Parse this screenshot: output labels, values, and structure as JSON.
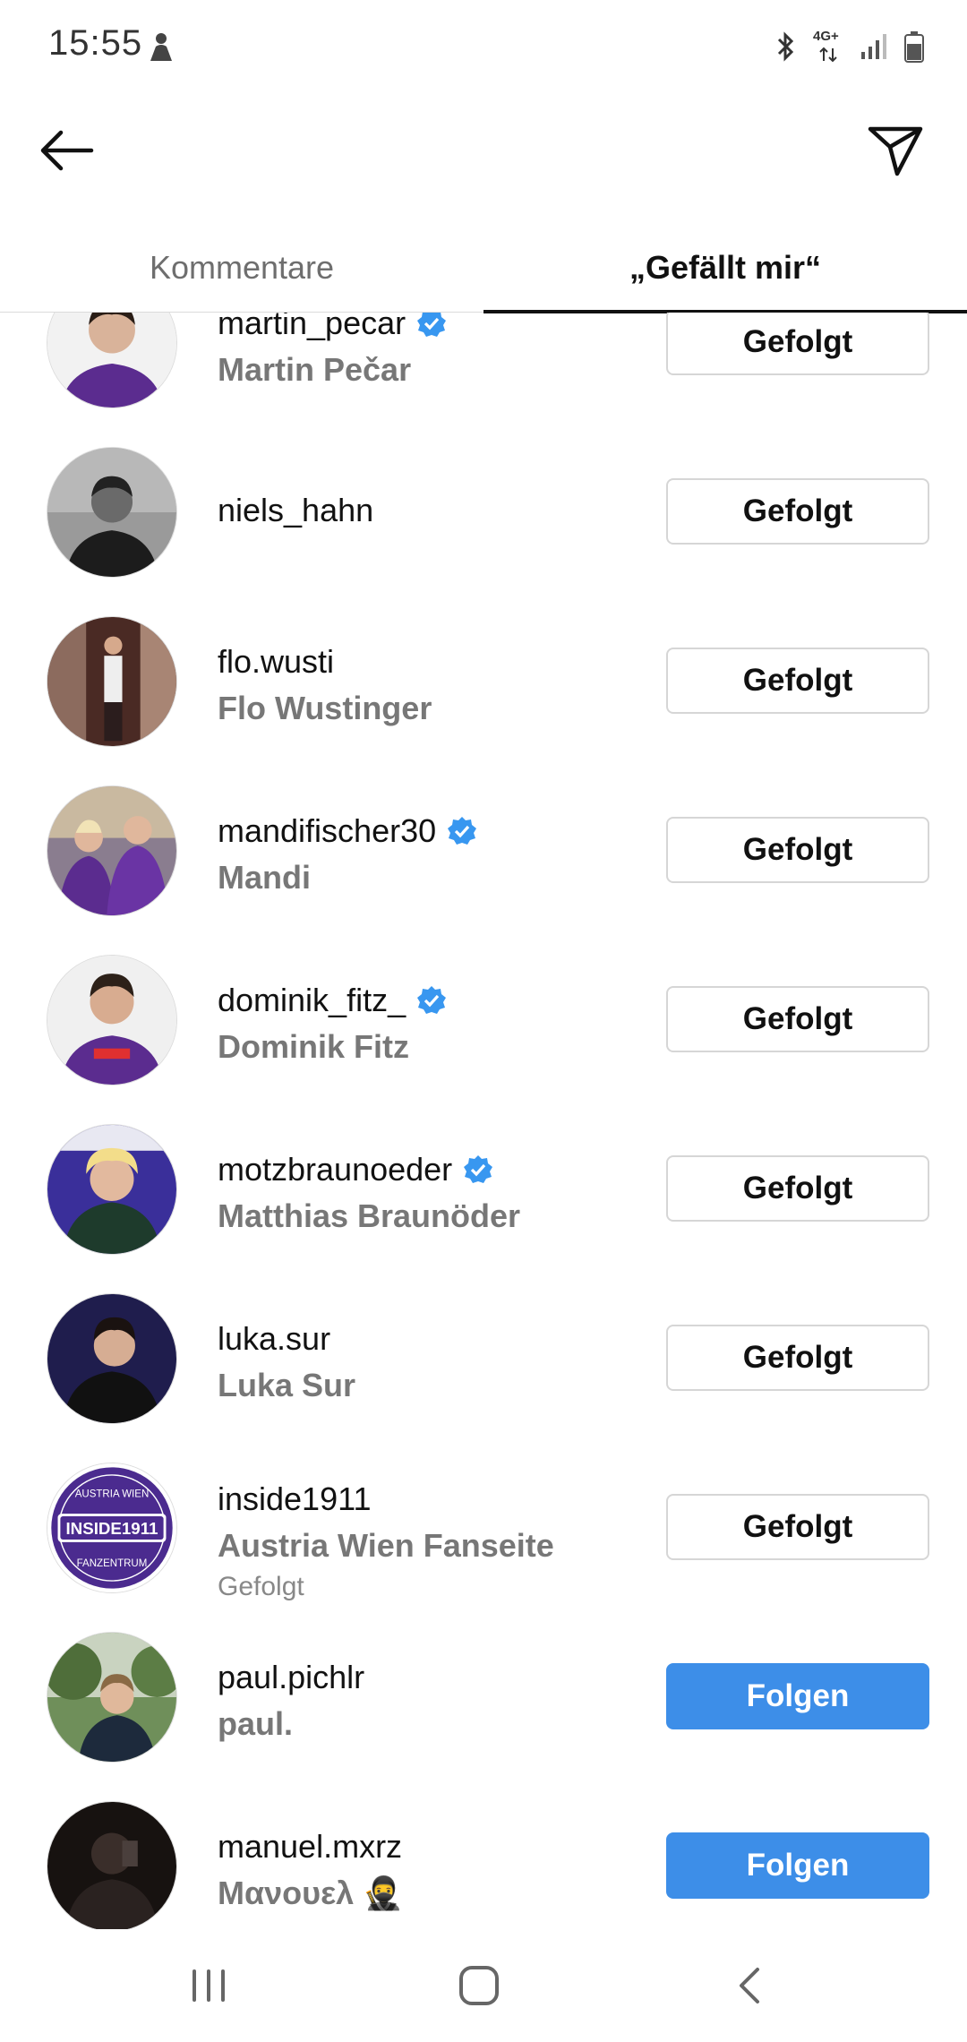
{
  "status": {
    "time": "15:55",
    "network": "4G+"
  },
  "tabs": [
    {
      "label": "Kommentare"
    },
    {
      "label": "„Gefällt mir“"
    }
  ],
  "users": [
    {
      "username": "martin_pecar",
      "name": "Martin Pečar",
      "verified": true,
      "button": "Gefolgt"
    },
    {
      "username": "niels_hahn",
      "name": "",
      "verified": false,
      "button": "Gefolgt"
    },
    {
      "username": "flo.wusti",
      "name": "Flo Wustinger",
      "verified": false,
      "button": "Gefolgt"
    },
    {
      "username": "mandifischer30",
      "name": "Mandi",
      "verified": true,
      "button": "Gefolgt"
    },
    {
      "username": "dominik_fitz_",
      "name": "Dominik Fitz",
      "verified": true,
      "button": "Gefolgt"
    },
    {
      "username": "motzbraunoeder",
      "name": "Matthias Braunöder",
      "verified": true,
      "button": "Gefolgt"
    },
    {
      "username": "luka.sur",
      "name": "Luka Sur",
      "verified": false,
      "button": "Gefolgt"
    },
    {
      "username": "inside1911",
      "name": "Austria Wien Fanseite",
      "sub": "Gefolgt",
      "verified": false,
      "button": "Gefolgt",
      "avatar_logo": {
        "top": "AUSTRIA WIEN",
        "center": "INSIDE1911",
        "bottom": "FANZENTRUM"
      }
    },
    {
      "username": "paul.pichlr",
      "name": "paul.",
      "verified": false,
      "button": "Folgen"
    },
    {
      "username": "manuel.mxrz",
      "name": "Μανουελ 🥷",
      "verified": false,
      "button": "Folgen"
    }
  ],
  "colors": {
    "accent": "#3d8ee8",
    "verified": "#3897f0",
    "purple": "#5b2c8f"
  }
}
